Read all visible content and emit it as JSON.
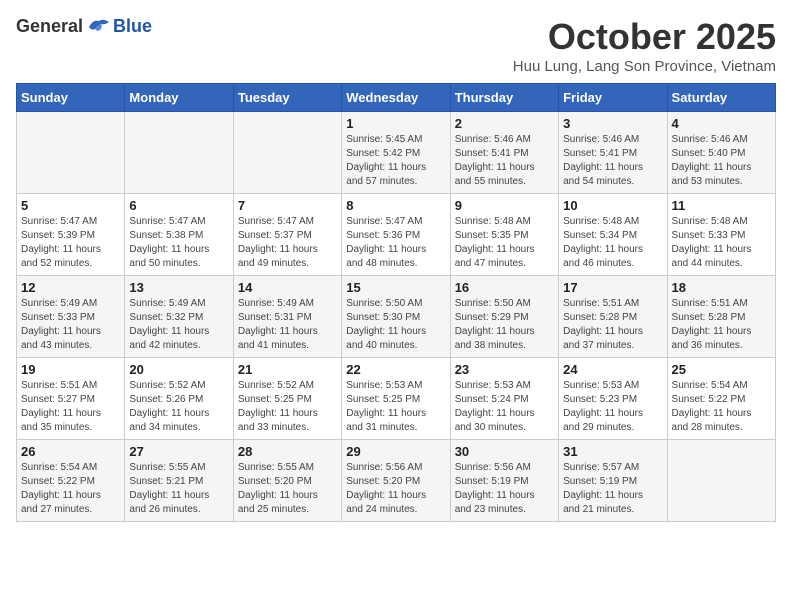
{
  "logo": {
    "general": "General",
    "blue": "Blue"
  },
  "header": {
    "month": "October 2025",
    "location": "Huu Lung, Lang Son Province, Vietnam"
  },
  "weekdays": [
    "Sunday",
    "Monday",
    "Tuesday",
    "Wednesday",
    "Thursday",
    "Friday",
    "Saturday"
  ],
  "weeks": [
    [
      {
        "day": "",
        "info": ""
      },
      {
        "day": "",
        "info": ""
      },
      {
        "day": "",
        "info": ""
      },
      {
        "day": "1",
        "info": "Sunrise: 5:45 AM\nSunset: 5:42 PM\nDaylight: 11 hours\nand 57 minutes."
      },
      {
        "day": "2",
        "info": "Sunrise: 5:46 AM\nSunset: 5:41 PM\nDaylight: 11 hours\nand 55 minutes."
      },
      {
        "day": "3",
        "info": "Sunrise: 5:46 AM\nSunset: 5:41 PM\nDaylight: 11 hours\nand 54 minutes."
      },
      {
        "day": "4",
        "info": "Sunrise: 5:46 AM\nSunset: 5:40 PM\nDaylight: 11 hours\nand 53 minutes."
      }
    ],
    [
      {
        "day": "5",
        "info": "Sunrise: 5:47 AM\nSunset: 5:39 PM\nDaylight: 11 hours\nand 52 minutes."
      },
      {
        "day": "6",
        "info": "Sunrise: 5:47 AM\nSunset: 5:38 PM\nDaylight: 11 hours\nand 50 minutes."
      },
      {
        "day": "7",
        "info": "Sunrise: 5:47 AM\nSunset: 5:37 PM\nDaylight: 11 hours\nand 49 minutes."
      },
      {
        "day": "8",
        "info": "Sunrise: 5:47 AM\nSunset: 5:36 PM\nDaylight: 11 hours\nand 48 minutes."
      },
      {
        "day": "9",
        "info": "Sunrise: 5:48 AM\nSunset: 5:35 PM\nDaylight: 11 hours\nand 47 minutes."
      },
      {
        "day": "10",
        "info": "Sunrise: 5:48 AM\nSunset: 5:34 PM\nDaylight: 11 hours\nand 46 minutes."
      },
      {
        "day": "11",
        "info": "Sunrise: 5:48 AM\nSunset: 5:33 PM\nDaylight: 11 hours\nand 44 minutes."
      }
    ],
    [
      {
        "day": "12",
        "info": "Sunrise: 5:49 AM\nSunset: 5:33 PM\nDaylight: 11 hours\nand 43 minutes."
      },
      {
        "day": "13",
        "info": "Sunrise: 5:49 AM\nSunset: 5:32 PM\nDaylight: 11 hours\nand 42 minutes."
      },
      {
        "day": "14",
        "info": "Sunrise: 5:49 AM\nSunset: 5:31 PM\nDaylight: 11 hours\nand 41 minutes."
      },
      {
        "day": "15",
        "info": "Sunrise: 5:50 AM\nSunset: 5:30 PM\nDaylight: 11 hours\nand 40 minutes."
      },
      {
        "day": "16",
        "info": "Sunrise: 5:50 AM\nSunset: 5:29 PM\nDaylight: 11 hours\nand 38 minutes."
      },
      {
        "day": "17",
        "info": "Sunrise: 5:51 AM\nSunset: 5:28 PM\nDaylight: 11 hours\nand 37 minutes."
      },
      {
        "day": "18",
        "info": "Sunrise: 5:51 AM\nSunset: 5:28 PM\nDaylight: 11 hours\nand 36 minutes."
      }
    ],
    [
      {
        "day": "19",
        "info": "Sunrise: 5:51 AM\nSunset: 5:27 PM\nDaylight: 11 hours\nand 35 minutes."
      },
      {
        "day": "20",
        "info": "Sunrise: 5:52 AM\nSunset: 5:26 PM\nDaylight: 11 hours\nand 34 minutes."
      },
      {
        "day": "21",
        "info": "Sunrise: 5:52 AM\nSunset: 5:25 PM\nDaylight: 11 hours\nand 33 minutes."
      },
      {
        "day": "22",
        "info": "Sunrise: 5:53 AM\nSunset: 5:25 PM\nDaylight: 11 hours\nand 31 minutes."
      },
      {
        "day": "23",
        "info": "Sunrise: 5:53 AM\nSunset: 5:24 PM\nDaylight: 11 hours\nand 30 minutes."
      },
      {
        "day": "24",
        "info": "Sunrise: 5:53 AM\nSunset: 5:23 PM\nDaylight: 11 hours\nand 29 minutes."
      },
      {
        "day": "25",
        "info": "Sunrise: 5:54 AM\nSunset: 5:22 PM\nDaylight: 11 hours\nand 28 minutes."
      }
    ],
    [
      {
        "day": "26",
        "info": "Sunrise: 5:54 AM\nSunset: 5:22 PM\nDaylight: 11 hours\nand 27 minutes."
      },
      {
        "day": "27",
        "info": "Sunrise: 5:55 AM\nSunset: 5:21 PM\nDaylight: 11 hours\nand 26 minutes."
      },
      {
        "day": "28",
        "info": "Sunrise: 5:55 AM\nSunset: 5:20 PM\nDaylight: 11 hours\nand 25 minutes."
      },
      {
        "day": "29",
        "info": "Sunrise: 5:56 AM\nSunset: 5:20 PM\nDaylight: 11 hours\nand 24 minutes."
      },
      {
        "day": "30",
        "info": "Sunrise: 5:56 AM\nSunset: 5:19 PM\nDaylight: 11 hours\nand 23 minutes."
      },
      {
        "day": "31",
        "info": "Sunrise: 5:57 AM\nSunset: 5:19 PM\nDaylight: 11 hours\nand 21 minutes."
      },
      {
        "day": "",
        "info": ""
      }
    ]
  ]
}
